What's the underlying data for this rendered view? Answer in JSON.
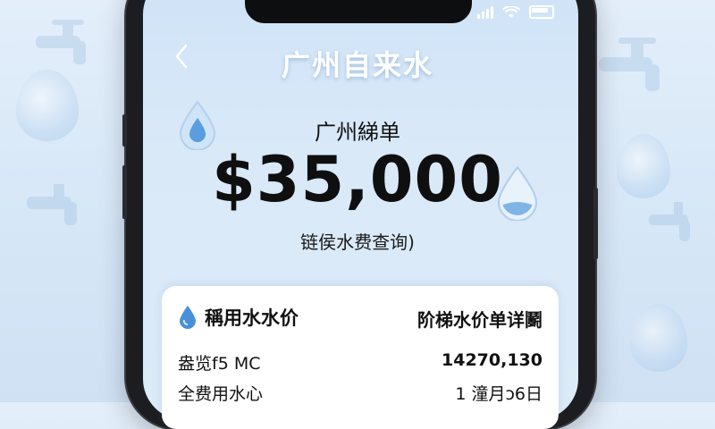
{
  "header": {
    "back_label": "‹",
    "title": "广州自来水"
  },
  "summary": {
    "subtitle": "广州綈单",
    "amount": "$35,000",
    "query_link": "链侯水费查询)"
  },
  "card": {
    "title": "稱用水水价",
    "detail_link": "阶梯水价单详鬬",
    "rows": [
      {
        "label": "盎览f5 MC",
        "value": "14270,130"
      },
      {
        "label": "全费用水心",
        "value": "1 潼月ɔ6日"
      }
    ]
  },
  "colors": {
    "title_white": "#ffffff",
    "screen_bg": "#d9e9f8",
    "drop_blue": "#4a90d9",
    "amount_black": "#0f0f10"
  },
  "icons": {
    "back": "chevron-left-icon",
    "drop": "water-drop-icon",
    "card_drop": "water-drop-icon"
  }
}
